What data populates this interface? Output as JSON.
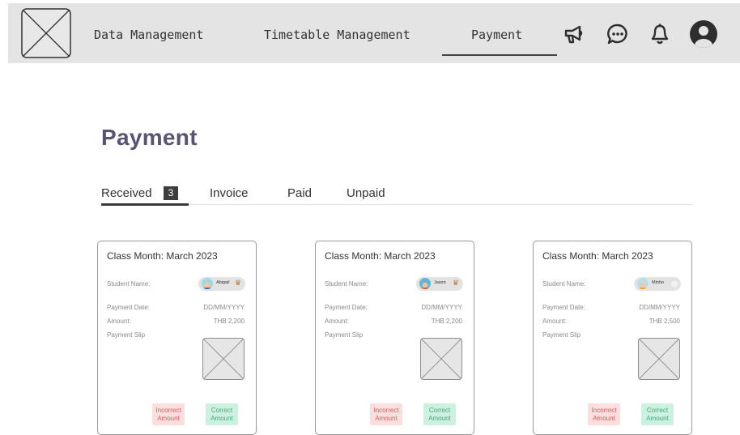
{
  "nav": {
    "items": [
      "Data Management",
      "Timetable Management",
      "Payment"
    ],
    "active": "Payment",
    "icons": [
      "megaphone-icon",
      "chat-icon",
      "bell-icon",
      "user-account-icon"
    ]
  },
  "page": {
    "title": "Payment"
  },
  "tabs": {
    "received": "Received",
    "received_count": "3",
    "invoice": "Invoice",
    "paid": "Paid",
    "unpaid": "Unpaid"
  },
  "cards": [
    {
      "title": "Class Month: March 2023",
      "student_label": "Student Name:",
      "student_name": "Abigail",
      "payment_date_label": "Payment Date:",
      "payment_date": "DD/MM/YYYY",
      "amount_label": "Amount:",
      "amount": "THB 2,200",
      "slip_label": "Payment Slip",
      "incorrect_label": "Incorrect Amount",
      "correct_label": "Correct Amount"
    },
    {
      "title": "Class Month: March 2023",
      "student_label": "Student Name:",
      "student_name": "Jason",
      "payment_date_label": "Payment Date:",
      "payment_date": "DD/MM/YYYY",
      "amount_label": "Amount:",
      "amount": "THB 2,200",
      "slip_label": "Payment Slip",
      "incorrect_label": "Incorrect Amount",
      "correct_label": "Correct Amount"
    },
    {
      "title": "Class Month: March 2023",
      "student_label": "Student Name:",
      "student_name": "Minho",
      "payment_date_label": "Payment Date:",
      "payment_date": "DD/MM/YYYY",
      "amount_label": "Amount:",
      "amount": "THB 2,500",
      "slip_label": "Payment Slip",
      "incorrect_label": "Incorrect Amount",
      "correct_label": "Correct Amount"
    }
  ],
  "colors": {
    "title": "#585374",
    "incorrect_bg": "#fbdede",
    "incorrect_text": "#d85d5d",
    "correct_bg": "#cdf1e0",
    "correct_text": "#47a87c"
  }
}
